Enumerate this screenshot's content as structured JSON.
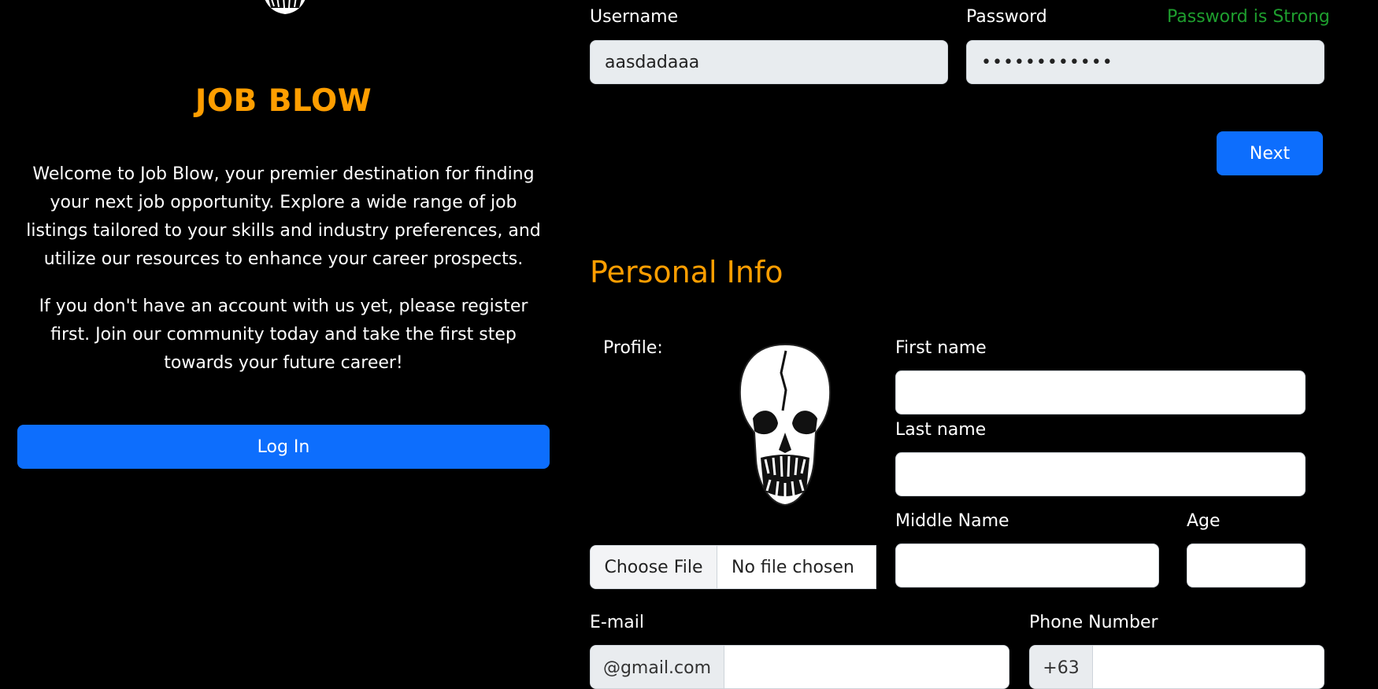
{
  "left": {
    "brand_title": "JOB BLOW",
    "intro_paragraph": "Welcome to Job Blow, your premier destination for finding your next job opportunity. Explore a wide range of job listings tailored to your skills and industry preferences, and utilize our resources to enhance your career prospects.",
    "register_paragraph": "If you don't have an account with us yet, please register first. Join our community today and take the first step towards your future career!",
    "login_button": "Log In",
    "logo_icon": "skull-logo-icon"
  },
  "account": {
    "username_label": "Username",
    "username_value": "aasdadaaa",
    "password_label": "Password",
    "password_value": "••••••••••••",
    "password_strength": "Password is Strong",
    "next_button": "Next"
  },
  "personal_info": {
    "title": "Personal Info",
    "profile_label": "Profile:",
    "avatar_icon": "skull-avatar-icon",
    "file_button": "Choose File",
    "file_status": "No file chosen",
    "first_name_label": "First name",
    "first_name_value": "",
    "last_name_label": "Last name",
    "last_name_value": "",
    "middle_name_label": "Middle Name",
    "middle_name_value": "",
    "age_label": "Age",
    "age_value": "",
    "email_label": "E-mail",
    "email_suffix": "@gmail.com",
    "email_value": "",
    "phone_label": "Phone Number",
    "phone_prefix": "+63",
    "phone_value": ""
  },
  "colors": {
    "background": "#000000",
    "accent": "#ff9e00",
    "primary_button": "#0d6efd",
    "success_text": "#1e9e2e"
  }
}
